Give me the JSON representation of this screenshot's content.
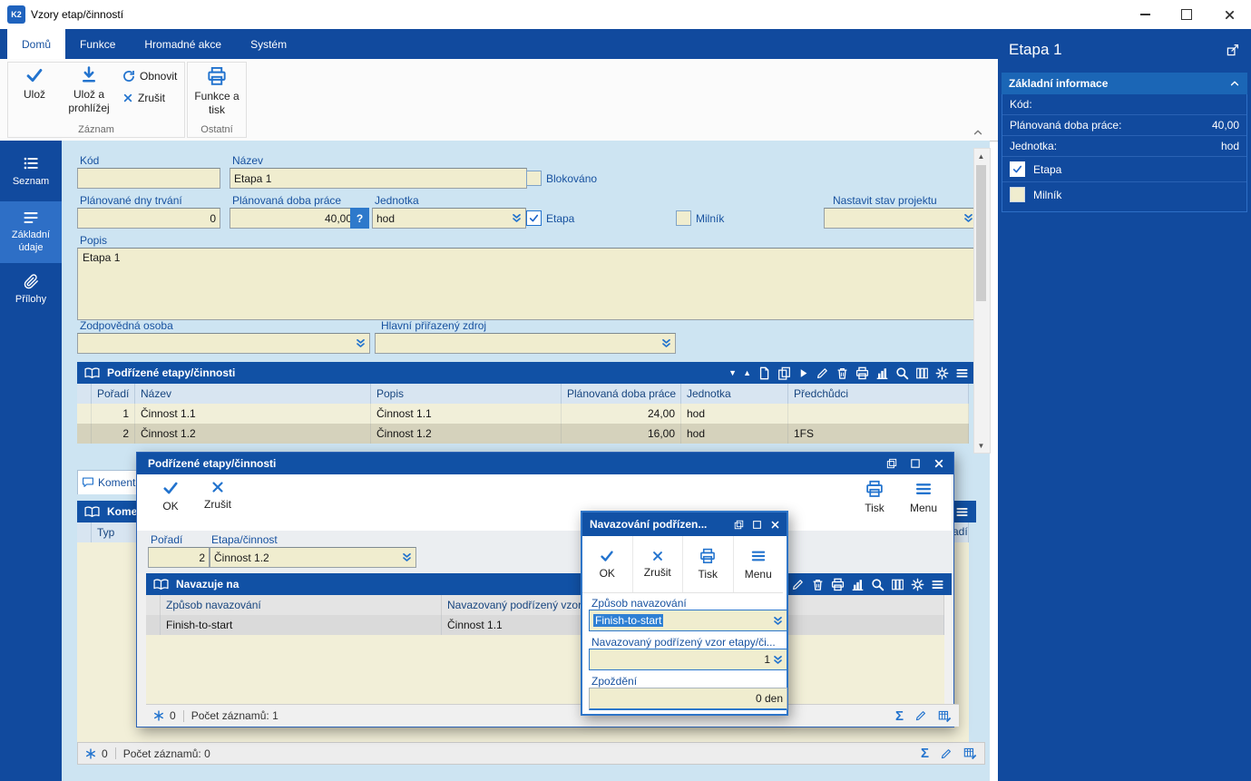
{
  "window": {
    "title": "Vzory etap/činností",
    "logo": "K2"
  },
  "ribbon": {
    "tabs": [
      "Domů",
      "Funkce",
      "Hromadné akce",
      "Systém"
    ],
    "save": "Ulož",
    "save_and_view": "Ulož a prohlížej",
    "refresh": "Obnovit",
    "cancel": "Zrušit",
    "functions_print": "Funkce a tisk",
    "group_record": "Záznam",
    "group_other": "Ostatní"
  },
  "sidebar": {
    "seznam": "Seznam",
    "zakladni_udaje": "Základní údaje",
    "prilohy": "Přílohy"
  },
  "form": {
    "kod_label": "Kód",
    "kod_value": "",
    "nazev_label": "Název",
    "nazev_value": "Etapa 1",
    "blokovano_label": "Blokováno",
    "plan_dny_label": "Plánované dny trvání",
    "plan_dny_value": "0",
    "plan_doba_label": "Plánovaná doba práce",
    "plan_doba_value": "40,00",
    "help_label": "?",
    "jednotka_label": "Jednotka",
    "jednotka_value": "hod",
    "etapa_label": "Etapa",
    "milnik_label": "Milník",
    "nastavit_label": "Nastavit stav projektu",
    "popis_label": "Popis",
    "popis_value": "Etapa 1",
    "zodpovedna_label": "Zodpovědná osoba",
    "hlavni_label": "Hlavní přiřazený zdroj"
  },
  "subtable": {
    "title": "Podřízené etapy/činnosti",
    "col_poradi": "Pořadí",
    "col_nazev": "Název",
    "col_popis": "Popis",
    "col_doba": "Plánovaná doba práce",
    "col_jednotka": "Jednotka",
    "col_predchudci": "Předchůdci",
    "rows": [
      [
        "1",
        "Činnost 1.1",
        "Činnost 1.1",
        "24,00",
        "hod",
        ""
      ],
      [
        "2",
        "Činnost 1.2",
        "Činnost 1.2",
        "16,00",
        "hod",
        "1FS"
      ]
    ]
  },
  "comments": {
    "tab": "Komentá",
    "table_title": "Komen",
    "col_typ": "Typ",
    "col_clipped": "řadí"
  },
  "statusbar": {
    "flag": "0",
    "records": "Počet záznamů: 0"
  },
  "dialog1": {
    "title": "Podřízené etapy/činnosti",
    "ok": "OK",
    "cancel": "Zrušit",
    "print": "Tisk",
    "menu": "Menu",
    "poradi_label": "Pořadí",
    "poradi_value": "2",
    "etapa_label": "Etapa/činnost",
    "etapa_value": "Činnost 1.2",
    "table_title": "Navazuje na",
    "col_zpusob": "Způsob navazování",
    "col_navazovany": "Navazovaný podřízený vzor et...",
    "row": [
      "Finish-to-start",
      "Činnost 1.1"
    ],
    "flag": "0",
    "records": "Počet záznamů: 1"
  },
  "dialog2": {
    "title": "Navazování podřízen...",
    "ok": "OK",
    "cancel": "Zrušit",
    "print": "Tisk",
    "menu": "Menu",
    "zpusob_label": "Způsob navazování",
    "zpusob_value": "Finish-to-start",
    "navazovany_label": "Navazovaný podřízený vzor etapy/či...",
    "navazovany_value": "1",
    "zpozdeni_label": "Zpoždění",
    "zpozdeni_value": "0 den"
  },
  "panel": {
    "title": "Etapa 1",
    "section": "Základní informace",
    "kod_label": "Kód:",
    "kod_value": "",
    "doba_label": "Plánovaná doba práce:",
    "doba_value": "40,00",
    "jednotka_label": "Jednotka:",
    "jednotka_value": "hod",
    "etapa_label": "Etapa",
    "milnik_label": "Milník"
  },
  "colors": {
    "brand_blue": "#114A9E",
    "bar_blue": "#1151A5",
    "section_blue": "#1B66B6",
    "active_item_blue": "#2E6FC6",
    "content_bg": "#CDE4F2",
    "input_cream": "#F0EDCF",
    "row_cream": "#F1EFD9",
    "row_selected": "#D5D2BC",
    "selection_highlight": "#2F80D4"
  }
}
